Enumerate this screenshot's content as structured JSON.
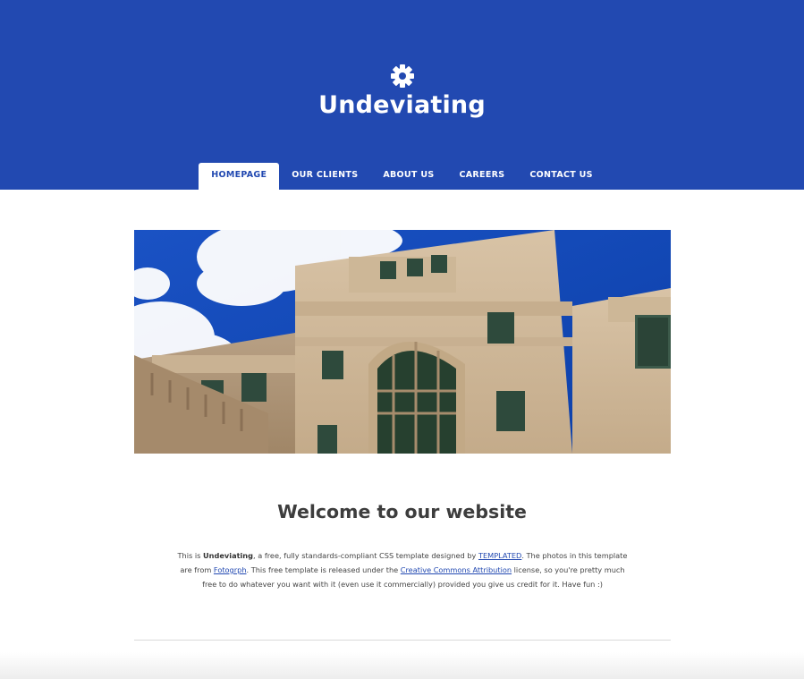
{
  "colors": {
    "brand": "#2249b1",
    "text": "#444444",
    "heading": "#3d3d3d",
    "divider": "#d9d9d9"
  },
  "header": {
    "logo_icon": "gear-icon",
    "title": "Undeviating"
  },
  "nav": {
    "items": [
      {
        "label": "HOMEPAGE",
        "active": true
      },
      {
        "label": "OUR CLIENTS",
        "active": false
      },
      {
        "label": "ABOUT US",
        "active": false
      },
      {
        "label": "CAREERS",
        "active": false
      },
      {
        "label": "CONTACT US",
        "active": false
      }
    ]
  },
  "banner": {
    "image": "building-photo"
  },
  "main": {
    "heading": "Welcome to our website",
    "intro": {
      "p1": "This is ",
      "brand": "Undeviating",
      "p2": ", a free, fully standards-compliant CSS template designed by ",
      "link1": "TEMPLATED",
      "p3": ". The photos in this template are from ",
      "link2": "Fotogrph",
      "p4": ". This free template is released under the ",
      "link3": "Creative Commons Attribution",
      "p5": " license, so you're pretty much free to do whatever you want with it (even use it commercially) provided you give us credit for it. Have fun :)"
    }
  }
}
